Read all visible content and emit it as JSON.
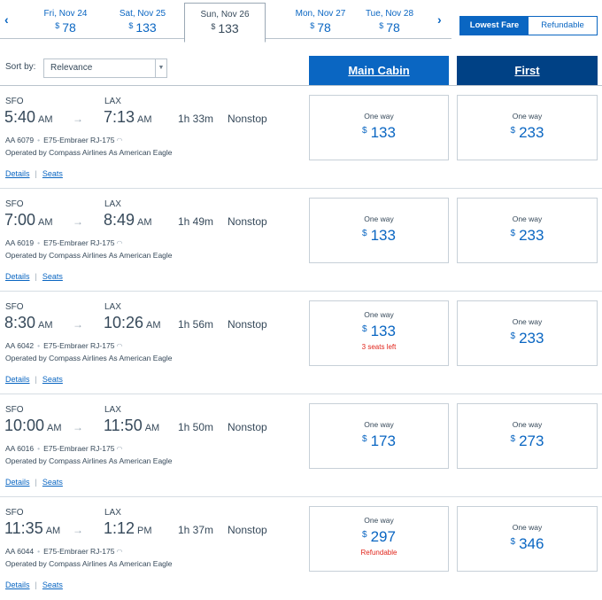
{
  "date_strip": {
    "dates": [
      {
        "label": "Fri, Nov 24",
        "currency": "$",
        "price": "78"
      },
      {
        "label": "Sat, Nov 25",
        "currency": "$",
        "price": "133"
      },
      {
        "label": "Sun, Nov 26",
        "currency": "$",
        "price": "133"
      },
      {
        "label": "Mon, Nov 27",
        "currency": "$",
        "price": "78"
      },
      {
        "label": "Tue, Nov 28",
        "currency": "$",
        "price": "78"
      }
    ],
    "selected_index": 2
  },
  "fare_toggle": {
    "lowest": "Lowest Fare",
    "refundable": "Refundable",
    "active": "lowest"
  },
  "sort": {
    "label": "Sort by:",
    "value": "Relevance"
  },
  "cabins": {
    "main": "Main Cabin",
    "first": "First"
  },
  "links": {
    "details": "Details",
    "seats": "Seats",
    "separator": "|"
  },
  "flights": [
    {
      "origin": "SFO",
      "dest": "LAX",
      "dep_time": "5:40",
      "dep_ampm": "AM",
      "arr_time": "7:13",
      "arr_ampm": "AM",
      "duration": "1h 33m",
      "stops": "Nonstop",
      "flight_no": "AA 6079",
      "aircraft": "E75-Embraer RJ-175",
      "operated": "Operated by Compass Airlines As American Eagle",
      "main": {
        "label": "One way",
        "currency": "$",
        "price": "133",
        "note": ""
      },
      "first": {
        "label": "One way",
        "currency": "$",
        "price": "233",
        "note": ""
      }
    },
    {
      "origin": "SFO",
      "dest": "LAX",
      "dep_time": "7:00",
      "dep_ampm": "AM",
      "arr_time": "8:49",
      "arr_ampm": "AM",
      "duration": "1h 49m",
      "stops": "Nonstop",
      "flight_no": "AA 6019",
      "aircraft": "E75-Embraer RJ-175",
      "operated": "Operated by Compass Airlines As American Eagle",
      "main": {
        "label": "One way",
        "currency": "$",
        "price": "133",
        "note": ""
      },
      "first": {
        "label": "One way",
        "currency": "$",
        "price": "233",
        "note": ""
      }
    },
    {
      "origin": "SFO",
      "dest": "LAX",
      "dep_time": "8:30",
      "dep_ampm": "AM",
      "arr_time": "10:26",
      "arr_ampm": "AM",
      "duration": "1h 56m",
      "stops": "Nonstop",
      "flight_no": "AA 6042",
      "aircraft": "E75-Embraer RJ-175",
      "operated": "Operated by Compass Airlines As American Eagle",
      "main": {
        "label": "One way",
        "currency": "$",
        "price": "133",
        "note": "3 seats left"
      },
      "first": {
        "label": "One way",
        "currency": "$",
        "price": "233",
        "note": ""
      }
    },
    {
      "origin": "SFO",
      "dest": "LAX",
      "dep_time": "10:00",
      "dep_ampm": "AM",
      "arr_time": "11:50",
      "arr_ampm": "AM",
      "duration": "1h 50m",
      "stops": "Nonstop",
      "flight_no": "AA 6016",
      "aircraft": "E75-Embraer RJ-175",
      "operated": "Operated by Compass Airlines As American Eagle",
      "main": {
        "label": "One way",
        "currency": "$",
        "price": "173",
        "note": ""
      },
      "first": {
        "label": "One way",
        "currency": "$",
        "price": "273",
        "note": ""
      }
    },
    {
      "origin": "SFO",
      "dest": "LAX",
      "dep_time": "11:35",
      "dep_ampm": "AM",
      "arr_time": "1:12",
      "arr_ampm": "PM",
      "duration": "1h 37m",
      "stops": "Nonstop",
      "flight_no": "AA 6044",
      "aircraft": "E75-Embraer RJ-175",
      "operated": "Operated by Compass Airlines As American Eagle",
      "main": {
        "label": "One way",
        "currency": "$",
        "price": "297",
        "note": "Refundable"
      },
      "first": {
        "label": "One way",
        "currency": "$",
        "price": "346",
        "note": ""
      }
    }
  ]
}
